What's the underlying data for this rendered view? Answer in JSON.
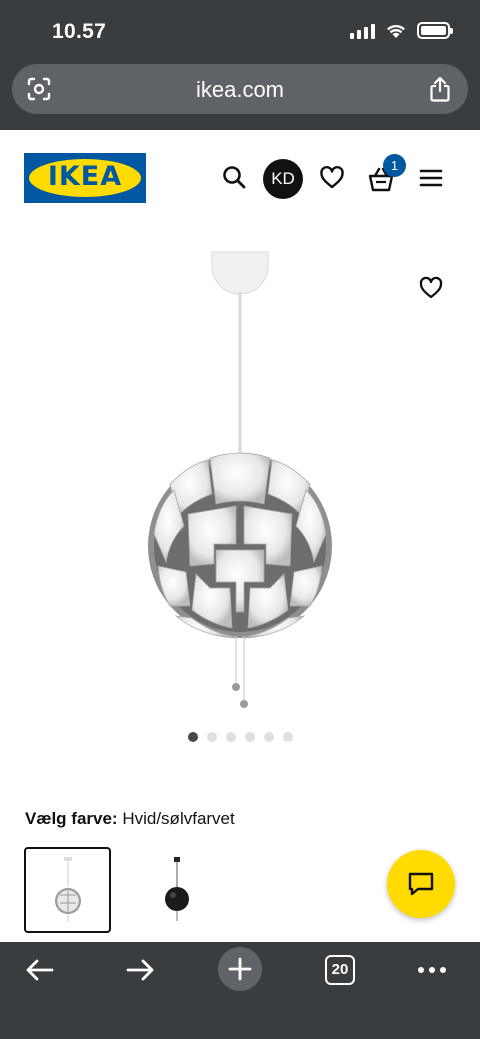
{
  "status_bar": {
    "time": "10.57"
  },
  "browser": {
    "url": "ikea.com",
    "tab_count": "20",
    "icons": {
      "page_tools": "camera-scan-icon",
      "share": "share-icon",
      "back": "arrow-left-icon",
      "forward": "arrow-right-icon",
      "new_tab": "plus-icon",
      "menu": "more-dots-icon"
    }
  },
  "header": {
    "logo_text": "IKEA",
    "avatar_initials": "KD",
    "cart_count": "1",
    "brand_colors": {
      "blue": "#0058a3",
      "yellow": "#ffdb00"
    }
  },
  "gallery": {
    "image_count": 6,
    "active_index": 0
  },
  "color_picker": {
    "label": "Vælg farve:",
    "selected_value": "Hvid/sølvfarvet",
    "options_count": 2
  }
}
